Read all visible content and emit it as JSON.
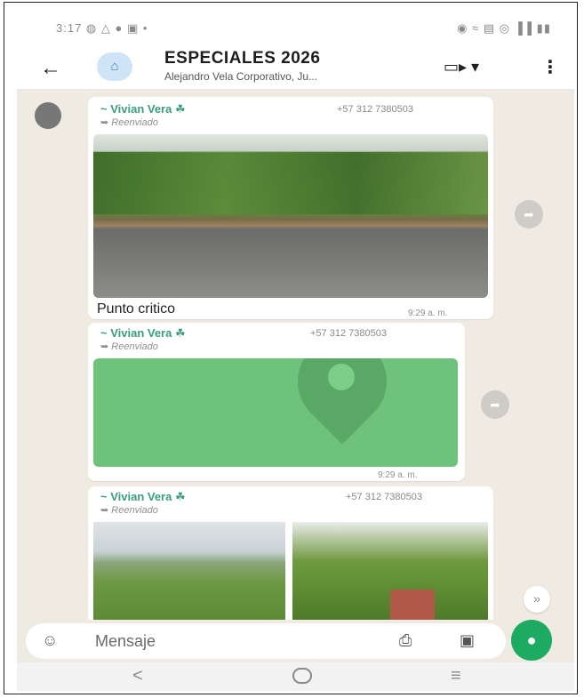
{
  "status_bar": {
    "time_and_icons": "3:17 ◍ △ ● ▣ •",
    "right_icons": "◉ ≈ ▤ ◎ ▐▐ ▮▮"
  },
  "header": {
    "back_icon": "←",
    "avatar_icon": "⌂",
    "title": "ESPECIALES 2026",
    "subtitle": "Alejandro Vela Corporativo, Ju...",
    "video_icon": "▭▸ ▾",
    "menu_icon": "⋮"
  },
  "messages": [
    {
      "sender": "~ Vivian Vera ☘",
      "phone": "+57 312 7380503",
      "forwarded": "➥ Reenviado",
      "caption": "Punto critico",
      "time": "9:29 a. m."
    },
    {
      "sender": "~ Vivian Vera ☘",
      "phone": "+57 312 7380503",
      "forwarded": "➥ Reenviado",
      "time": "9:29 a. m."
    },
    {
      "sender": "~ Vivian Vera ☘",
      "phone": "+57 312 7380503",
      "forwarded": "➥ Reenviado"
    }
  ],
  "share_icon": "➦",
  "scroll_down_icon": "»",
  "input_bar": {
    "emoji_icon": "☺",
    "placeholder": "Mensaje",
    "attach_icon": "⎙",
    "camera_icon": "▣",
    "mic_icon": "●"
  },
  "nav_bar": {
    "back_icon": "<",
    "recent_icon": "≡"
  },
  "colors": {
    "accent_green": "#1daa61",
    "sender_green": "#3b9e7a",
    "chat_bg": "#efeae2"
  }
}
